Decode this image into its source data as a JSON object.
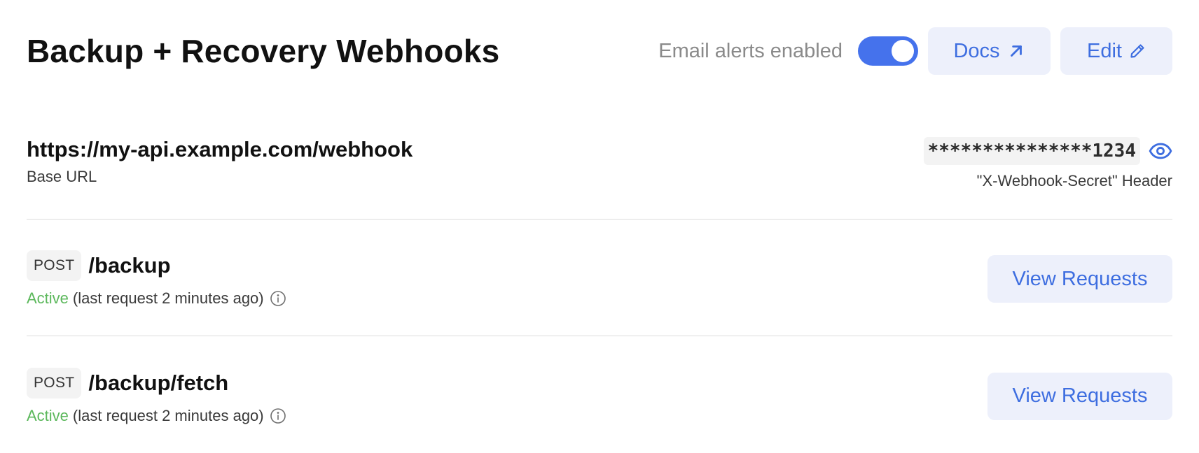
{
  "header": {
    "title": "Backup + Recovery Webhooks",
    "alerts_label": "Email alerts enabled",
    "alerts_enabled": true,
    "docs_label": "Docs",
    "edit_label": "Edit",
    "docs_icon": "arrow-up-right-icon",
    "edit_icon": "pencil-icon"
  },
  "base": {
    "url": "https://my-api.example.com/webhook",
    "url_caption": "Base URL",
    "secret_masked": "***************1234",
    "secret_caption": "\"X-Webhook-Secret\" Header",
    "reveal_icon": "eye-icon"
  },
  "endpoints": [
    {
      "method": "POST",
      "path": "/backup",
      "status": "Active",
      "detail": "(last request 2 minutes ago)",
      "button_label": "View Requests"
    },
    {
      "method": "POST",
      "path": "/backup/fetch",
      "status": "Active",
      "detail": "(last request 2 minutes ago)",
      "button_label": "View Requests"
    }
  ],
  "colors": {
    "accent": "#4572ec",
    "button_bg": "#edf0fb",
    "button_text": "#3e6ee0",
    "status_active": "#5cb85c"
  }
}
